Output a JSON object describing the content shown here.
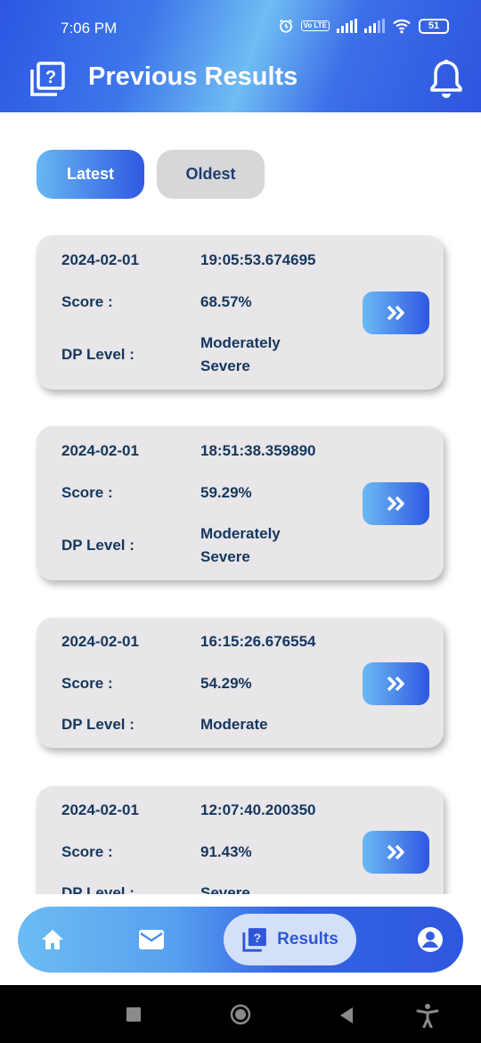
{
  "status": {
    "time": "7:06 PM",
    "battery": "51",
    "volte": "Vo LTE"
  },
  "header": {
    "title": "Previous Results",
    "title_icon": "question-book-icon",
    "bell_icon": "bell-icon"
  },
  "tabs": [
    {
      "label": "Latest",
      "active": true
    },
    {
      "label": "Oldest",
      "active": false
    }
  ],
  "results_labels": {
    "score": "Score :",
    "level": "DP Level :"
  },
  "results": [
    {
      "date": "2024-02-01",
      "time": "19:05:53.674695",
      "score": "68.57%",
      "level": "Moderately Severe"
    },
    {
      "date": "2024-02-01",
      "time": "18:51:38.359890",
      "score": "59.29%",
      "level": "Moderately Severe"
    },
    {
      "date": "2024-02-01",
      "time": "16:15:26.676554",
      "score": "54.29%",
      "level": "Moderate"
    },
    {
      "date": "2024-02-01",
      "time": "12:07:40.200350",
      "score": "91.43%",
      "level": "Severe"
    }
  ],
  "bottom_nav": {
    "home_icon": "home-icon",
    "mail_icon": "mail-icon",
    "results_label": "Results",
    "results_icon": "question-book-icon",
    "profile_icon": "profile-icon"
  },
  "colors": {
    "accent_dark": "#2f56e0",
    "accent_light": "#6bbaf3",
    "text_dark": "#15375f",
    "card_bg": "#e8e6e8"
  }
}
